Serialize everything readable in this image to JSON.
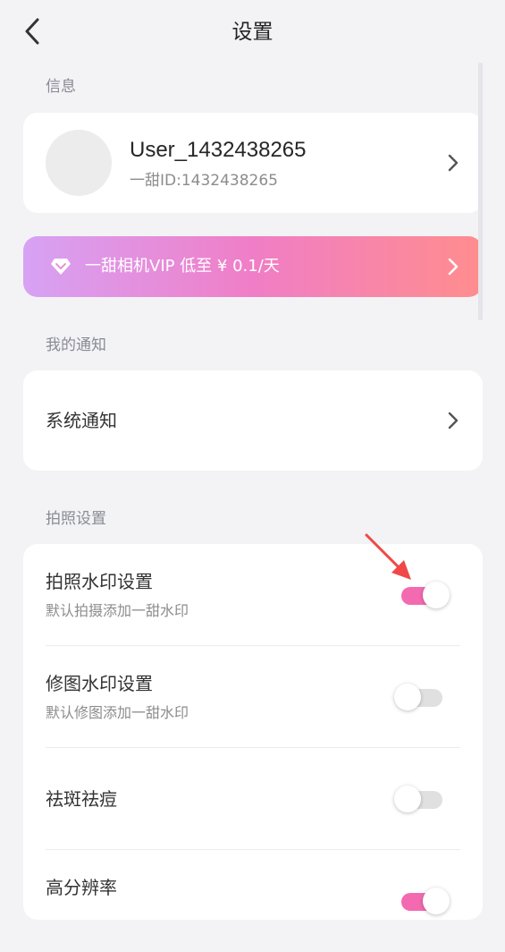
{
  "header": {
    "title": "设置",
    "back_icon": "chevron-left-icon"
  },
  "sections": {
    "info": "信息",
    "notifications": "我的通知",
    "camera": "拍照设置"
  },
  "profile": {
    "username": "User_1432438265",
    "user_id": "一甜ID:1432438265"
  },
  "vip": {
    "icon": "diamond-icon",
    "text": "一甜相机VIP 低至 ¥ 0.1/天"
  },
  "notify": {
    "label": "系统通知"
  },
  "settings": [
    {
      "title": "拍照水印设置",
      "desc": "默认拍摄添加一甜水印",
      "on": true
    },
    {
      "title": "修图水印设置",
      "desc": "默认修图添加一甜水印",
      "on": false
    },
    {
      "title": "祛斑祛痘",
      "desc": "",
      "on": false
    },
    {
      "title": "高分辨率",
      "desc": "",
      "on": true
    }
  ],
  "colors": {
    "accent": "#f36ab0",
    "annotation_arrow": "#f04848",
    "background": "#f3f3f6"
  }
}
